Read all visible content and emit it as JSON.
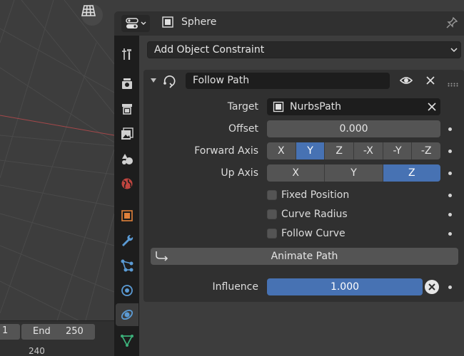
{
  "header": {
    "object_name": "Sphere"
  },
  "add_constraint": {
    "label": "Add Object Constraint"
  },
  "constraint": {
    "name": "Follow Path",
    "target_label": "Target",
    "target_value": "NurbsPath",
    "offset_label": "Offset",
    "offset_value": "0.000",
    "forward_axis_label": "Forward Axis",
    "forward_axis_options": [
      "X",
      "Y",
      "Z",
      "-X",
      "-Y",
      "-Z"
    ],
    "forward_axis_selected": "Y",
    "up_axis_label": "Up Axis",
    "up_axis_options": [
      "X",
      "Y",
      "Z"
    ],
    "up_axis_selected": "Z",
    "fixed_position": "Fixed Position",
    "curve_radius": "Curve Radius",
    "follow_curve": "Follow Curve",
    "animate_path": "Animate Path",
    "influence_label": "Influence",
    "influence_value": "1.000"
  },
  "timeline": {
    "start": "1",
    "end_label": "End",
    "end_value": "250",
    "frame": "240"
  },
  "colors": {
    "accent": "#4772b3",
    "panel": "#303030",
    "field": "#545454",
    "dark": "#1d1d1d"
  }
}
